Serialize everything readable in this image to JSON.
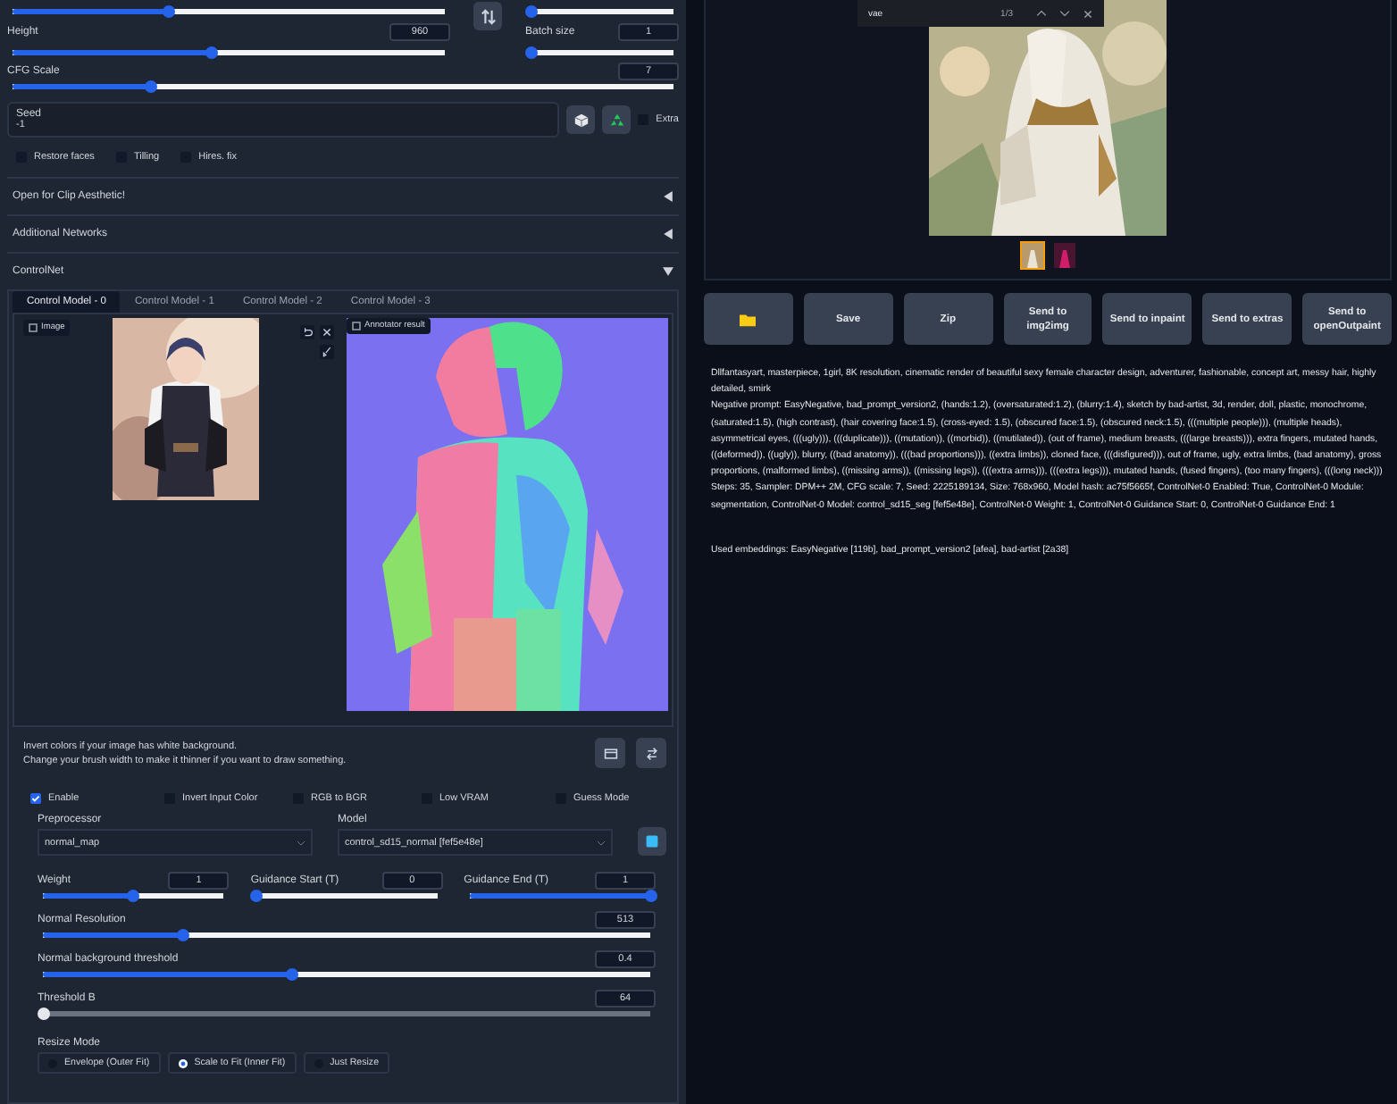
{
  "generation": {
    "width_slider": {
      "level": 0.36
    },
    "batch_count_slider": {
      "level": 0
    },
    "height": {
      "label": "Height",
      "value": "960",
      "level": 0.46
    },
    "batch_size": {
      "label": "Batch size",
      "value": "1",
      "level": 0
    },
    "cfg_scale": {
      "label": "CFG Scale",
      "value": "7",
      "level": 0.21
    },
    "seed": {
      "label": "Seed",
      "value": "-1"
    },
    "extra": {
      "label": "Extra",
      "checked": false
    },
    "options": [
      {
        "label": "Restore faces",
        "checked": false
      },
      {
        "label": "Tilling",
        "checked": false
      },
      {
        "label": "Hires. fix",
        "checked": false
      }
    ]
  },
  "accordions": [
    {
      "title": "Open for Clip Aesthetic!",
      "expanded": false
    },
    {
      "title": "Additional Networks",
      "expanded": false
    }
  ],
  "controlnet": {
    "title": "ControlNet",
    "expanded": true,
    "tabs": [
      {
        "label": "Control Model - 0",
        "selected": true
      },
      {
        "label": "Control Model - 1",
        "selected": false
      },
      {
        "label": "Control Model - 2",
        "selected": false
      },
      {
        "label": "Control Model - 3",
        "selected": false
      }
    ],
    "image_label": "Image",
    "result_label": "Annotator result",
    "hints": [
      "Invert colors if your image has white background.",
      "Change your brush width to make it thinner if you want to draw something."
    ],
    "options": [
      {
        "label": "Enable",
        "checked": true
      },
      {
        "label": "Invert Input Color",
        "checked": false
      },
      {
        "label": "RGB to BGR",
        "checked": false
      },
      {
        "label": "Low VRAM",
        "checked": false
      },
      {
        "label": "Guess Mode",
        "checked": false
      }
    ],
    "preprocessor": {
      "label": "Preprocessor",
      "value": "normal_map"
    },
    "model": {
      "label": "Model",
      "value": "control_sd15_normal [fef5e48e]"
    },
    "row_sliders": [
      {
        "label": "Weight",
        "value": "1",
        "level": 0.5
      },
      {
        "label": "Guidance Start (T)",
        "value": "0",
        "level": 0
      },
      {
        "label": "Guidance End (T)",
        "value": "1",
        "level": 1
      }
    ],
    "sliders": [
      {
        "label": "Normal Resolution",
        "value": "513",
        "level": 0.23,
        "disabled": false
      },
      {
        "label": "Normal background threshold",
        "value": "0.4",
        "level": 0.41,
        "disabled": false
      },
      {
        "label": "Threshold B",
        "value": "64",
        "level": 0,
        "disabled": true
      }
    ],
    "resize_mode": {
      "label": "Resize Mode",
      "options": [
        {
          "label": "Envelope (Outer Fit)",
          "selected": false
        },
        {
          "label": "Scale to Fit (Inner Fit)",
          "selected": true
        },
        {
          "label": "Just Resize",
          "selected": false
        }
      ]
    }
  },
  "find_bar": {
    "query": "vae",
    "count": "1/3"
  },
  "gallery": {
    "thumbnails": [
      {
        "selected": true
      },
      {
        "selected": false
      }
    ]
  },
  "actions": [
    {
      "kind": "folder"
    },
    {
      "kind": "text",
      "label": "Save"
    },
    {
      "kind": "text",
      "label": "Zip"
    },
    {
      "kind": "text",
      "label": "Send to img2img"
    },
    {
      "kind": "text",
      "label": "Send to inpaint"
    },
    {
      "kind": "text",
      "label": "Send to extras"
    },
    {
      "kind": "text",
      "label": "Send to openOutpaint"
    }
  ],
  "info": {
    "prompt": "Dllfantasyart, masterpiece, 1girl, 8K resolution, cinematic render of beautiful sexy female character design, adventurer, fashionable, concept art, messy hair, highly detailed, smirk",
    "negative_prompt": "Negative prompt: EasyNegative, bad_prompt_version2, (hands:1.2), (oversaturated:1.2), (blurry:1.4), sketch by bad-artist, 3d, render, doll, plastic, monochrome, (saturated:1.5), (high contrast), (hair covering face:1.5), (cross-eyed: 1.5), (obscured face:1.5), (obscured neck:1.5), (((multiple people))), (multiple heads), asymmetrical eyes, (((ugly))), (((duplicate))), ((mutation)), ((morbid)), ((mutilated)), (out of frame), medium breasts, (((large breasts))), extra fingers, mutated hands, ((deformed)), ((ugly)), blurry, ((bad anatomy)), (((bad proportions))), ((extra limbs)), cloned face, (((disfigured))), out of frame, ugly, extra limbs, (bad anatomy), gross proportions, (malformed limbs), ((missing arms)), ((missing legs)), (((extra arms))), (((extra legs))), mutated hands, (fused fingers), (too many fingers), (((long neck)))",
    "parameters": "Steps: 35, Sampler: DPM++ 2M, CFG scale: 7, Seed: 2225189134, Size: 768x960, Model hash: ac75f5665f, ControlNet-0 Enabled: True, ControlNet-0 Module: segmentation, ControlNet-0 Model: control_sd15_seg [fef5e48e], ControlNet-0 Weight: 1, ControlNet-0 Guidance Start: 0, ControlNet-0 Guidance End: 1",
    "embeddings": "Used embeddings: EasyNegative [119b], bad_prompt_version2 [afea], bad-artist [2a38]"
  }
}
